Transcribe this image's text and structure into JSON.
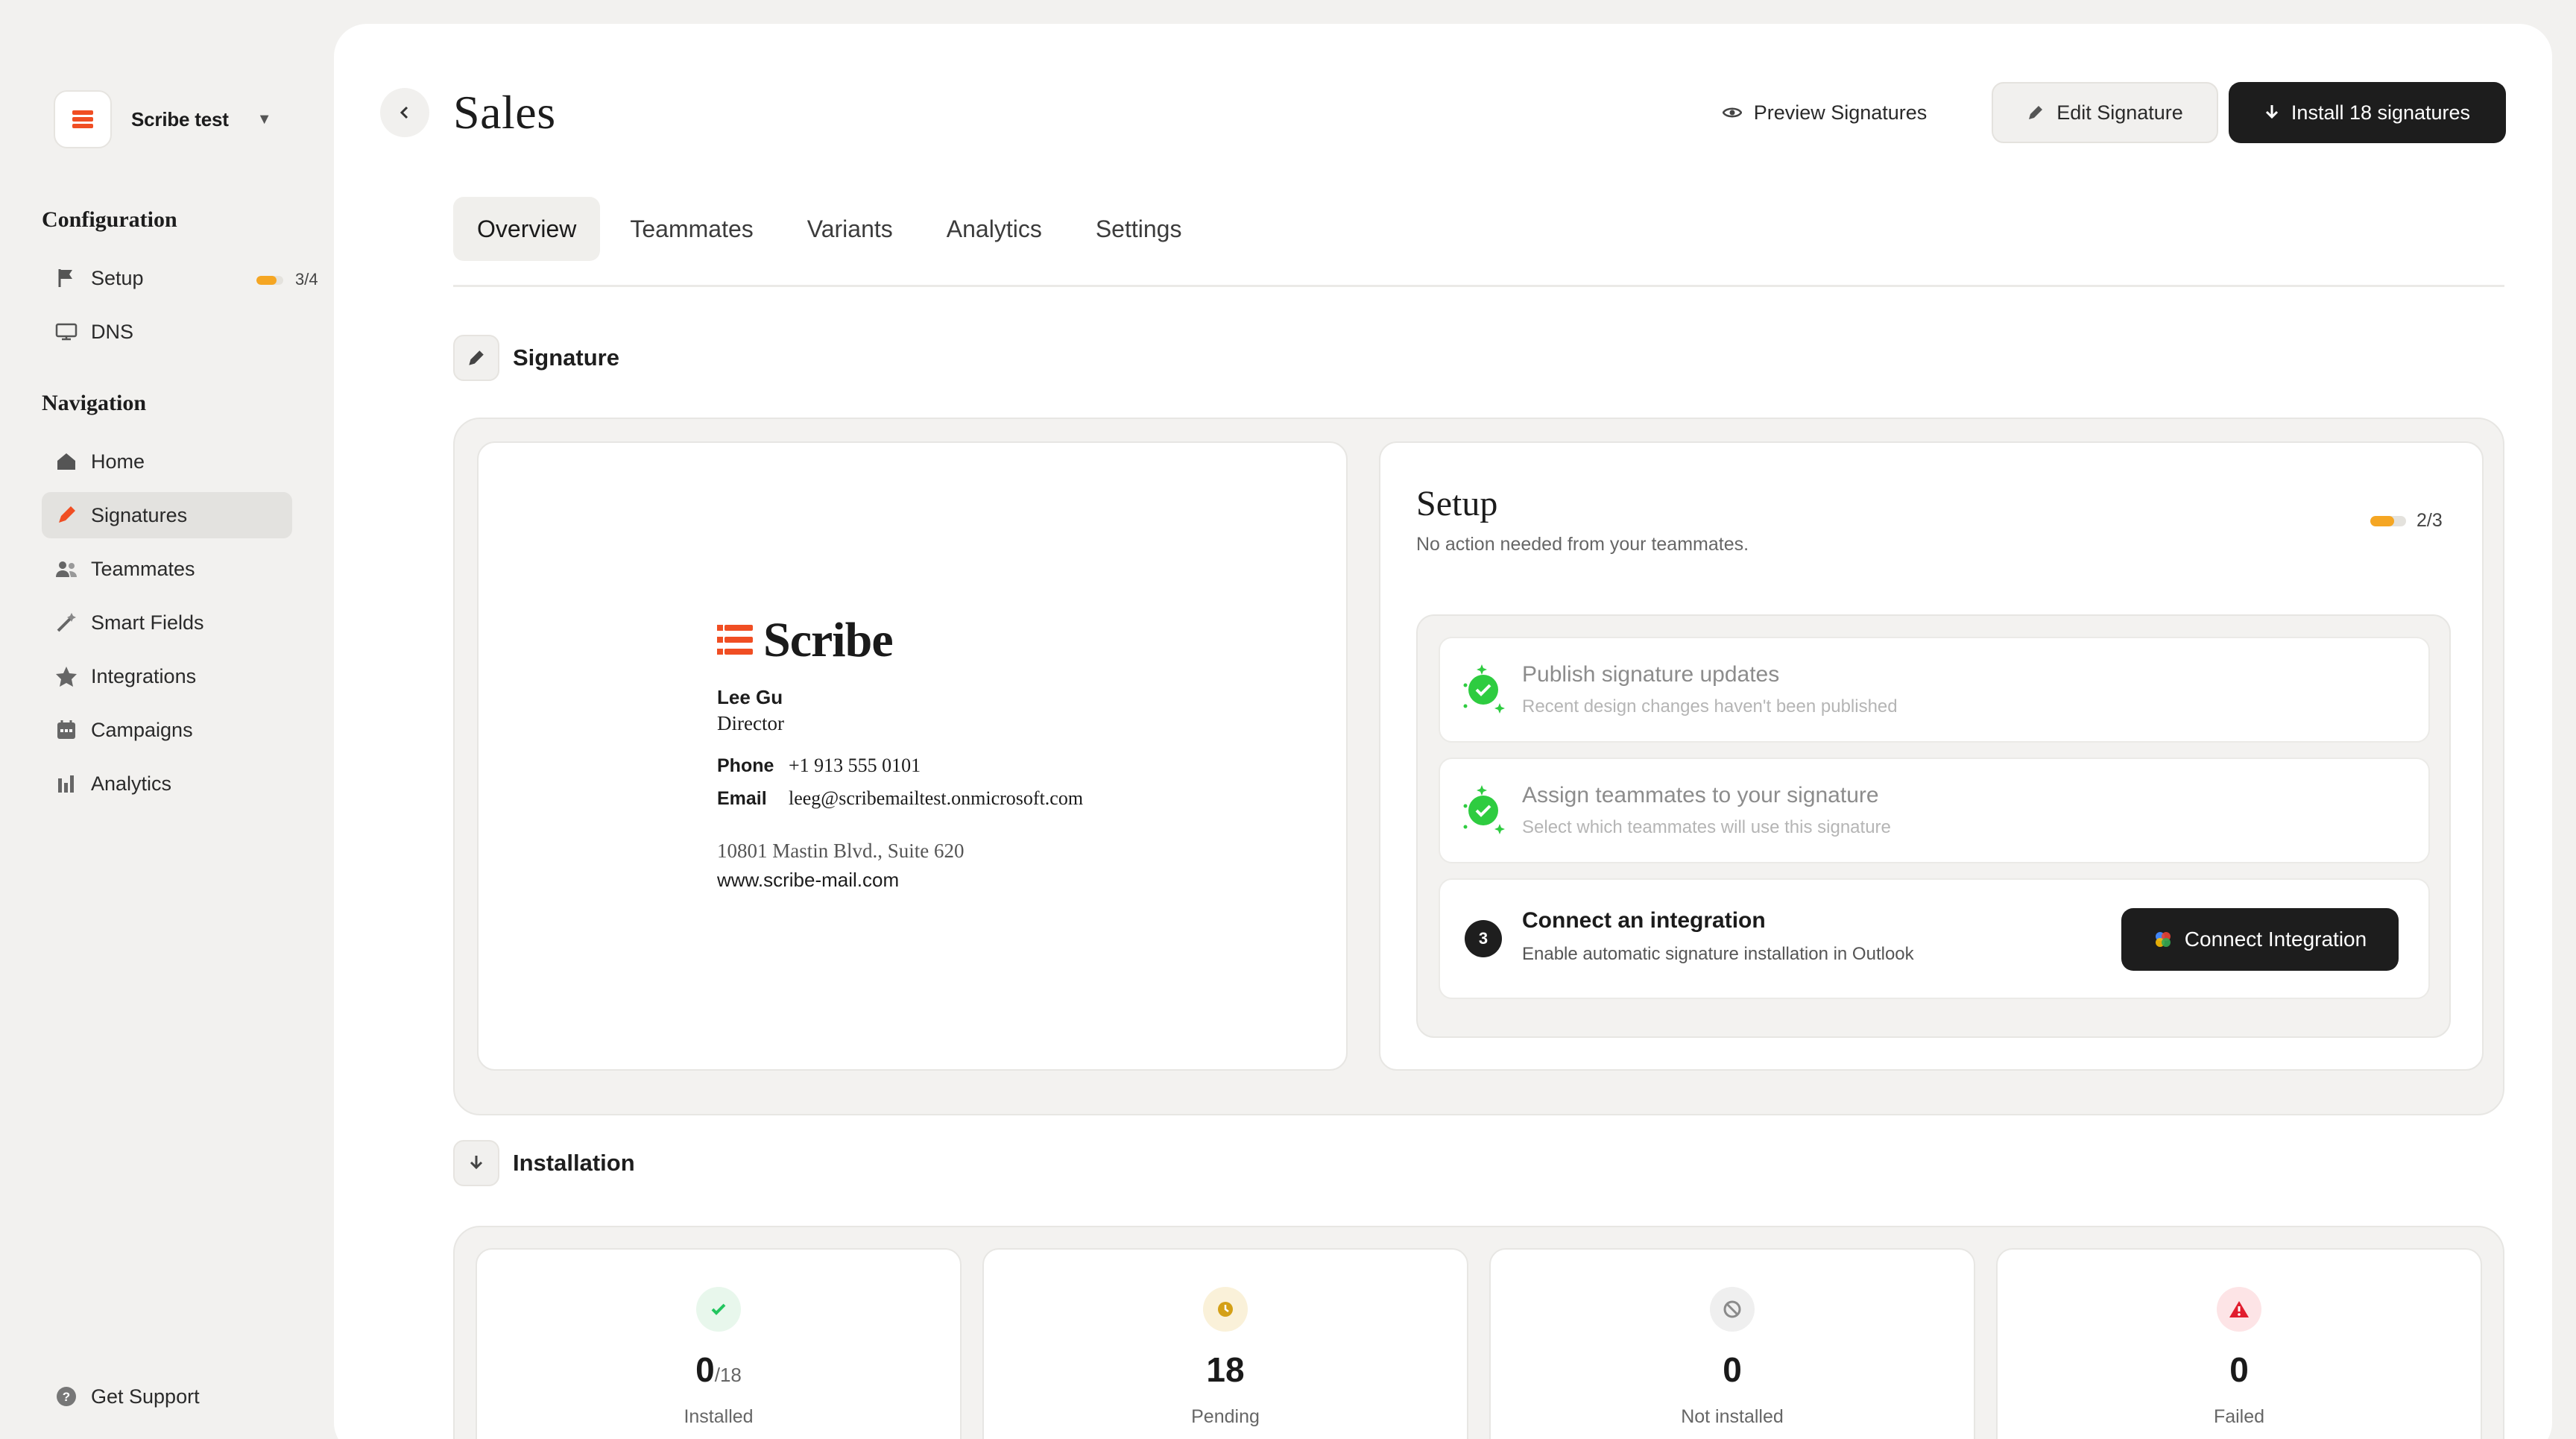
{
  "sidebar": {
    "workspace": {
      "name": "Scribe test"
    },
    "configuration": {
      "title": "Configuration",
      "items": [
        {
          "label": "Setup",
          "icon": "flag-icon",
          "progress_fraction": 0.75,
          "count": "3/4"
        },
        {
          "label": "DNS",
          "icon": "dns-icon"
        }
      ]
    },
    "navigation": {
      "title": "Navigation",
      "items": [
        {
          "label": "Home",
          "icon": "home-icon",
          "active": false
        },
        {
          "label": "Signatures",
          "icon": "pen-icon",
          "active": true
        },
        {
          "label": "Teammates",
          "icon": "users-icon",
          "active": false
        },
        {
          "label": "Smart Fields",
          "icon": "wand-icon",
          "active": false
        },
        {
          "label": "Integrations",
          "icon": "star-icon",
          "active": false
        },
        {
          "label": "Campaigns",
          "icon": "calendar-icon",
          "active": false
        },
        {
          "label": "Analytics",
          "icon": "bar-chart-icon",
          "active": false
        }
      ]
    },
    "support": {
      "label": "Get Support",
      "icon": "help-icon"
    }
  },
  "header": {
    "title": "Sales",
    "preview_label": "Preview Signatures",
    "edit_label": "Edit Signature",
    "install_label": "Install 18 signatures"
  },
  "tabs": [
    {
      "label": "Overview",
      "active": true
    },
    {
      "label": "Teammates",
      "active": false
    },
    {
      "label": "Variants",
      "active": false
    },
    {
      "label": "Analytics",
      "active": false
    },
    {
      "label": "Settings",
      "active": false
    }
  ],
  "signature_section": {
    "title": "Signature",
    "preview": {
      "brand": "Scribe",
      "name": "Lee Gu",
      "job_title": "Director",
      "phone_label": "Phone",
      "phone": "+1 913 555 0101",
      "email_label": "Email",
      "email": "leeg@scribemailtest.onmicrosoft.com",
      "address": "10801 Mastin Blvd., Suite 620",
      "website": "www.scribe-mail.com"
    },
    "setup": {
      "title": "Setup",
      "subtitle": "No action needed from your teammates.",
      "progress_fraction": 0.67,
      "count": "2/3",
      "steps": [
        {
          "title": "Publish signature updates",
          "subtitle": "Recent design changes haven't been published",
          "status": "done"
        },
        {
          "title": "Assign teammates to your signature",
          "subtitle": "Select which teammates will use this signature",
          "status": "done"
        },
        {
          "number": "3",
          "title": "Connect an integration",
          "subtitle": "Enable automatic signature installation in Outlook",
          "status": "todo",
          "button": "Connect Integration"
        }
      ]
    }
  },
  "installation_section": {
    "title": "Installation",
    "stats": [
      {
        "value": "0",
        "suffix": "/18",
        "label": "Installed",
        "icon": "check-circle-icon",
        "color": "#22c55e"
      },
      {
        "value": "18",
        "suffix": "",
        "label": "Pending",
        "icon": "clock-icon",
        "color": "#d4a017"
      },
      {
        "value": "0",
        "suffix": "",
        "label": "Not installed",
        "icon": "ban-icon",
        "color": "#8a8a8a"
      },
      {
        "value": "0",
        "suffix": "",
        "label": "Failed",
        "icon": "warning-icon",
        "color": "#e11d2e"
      }
    ]
  },
  "colors": {
    "accent": "#f04e23",
    "dark_button": "#1d1d1d",
    "progress": "#f5a623",
    "success": "#22c55e"
  }
}
